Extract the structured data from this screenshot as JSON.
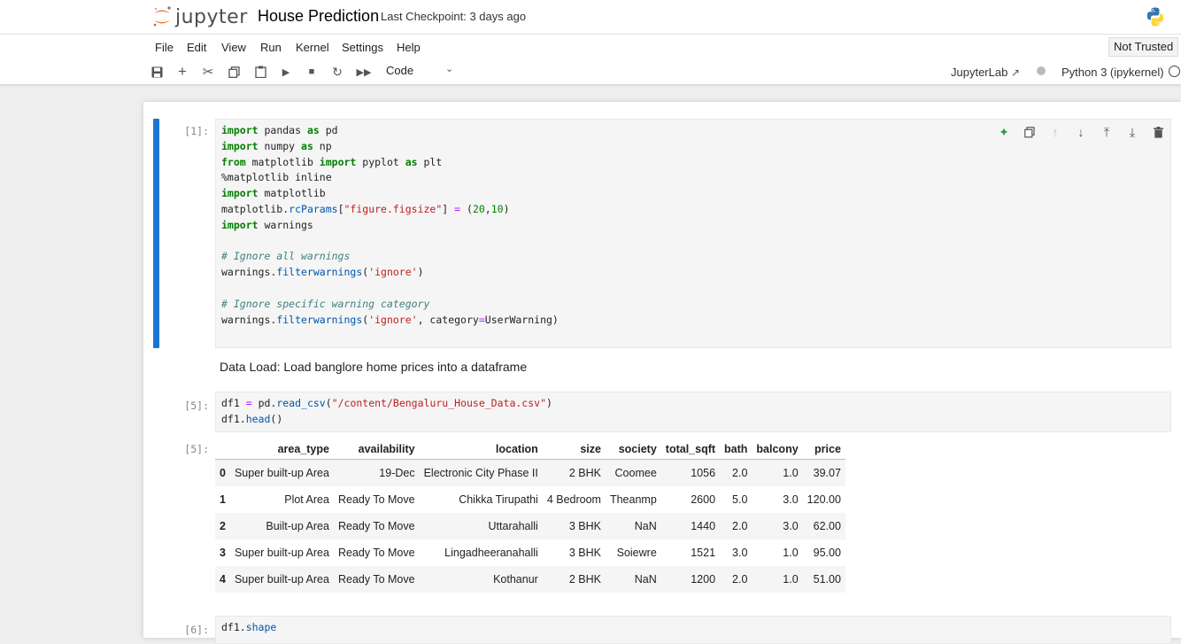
{
  "header": {
    "logo_text": "jupyter",
    "notebook_title": "House Prediction",
    "checkpoint": "Last Checkpoint: 3 days ago"
  },
  "menu": {
    "items": [
      "File",
      "Edit",
      "View",
      "Run",
      "Kernel",
      "Settings",
      "Help"
    ],
    "trust_status": "Not Trusted"
  },
  "toolbar": {
    "cell_type": "Code",
    "jupyterlab_link": "JupyterLab",
    "kernel": "Python 3 (ipykernel)"
  },
  "cells": [
    {
      "prompt": "[1]:",
      "lines": [
        "import pandas as pd",
        "import numpy as np",
        "from matplotlib import pyplot as plt",
        "%matplotlib inline",
        "import matplotlib",
        "matplotlib.rcParams[\"figure.figsize\"] = (20,10)",
        "import warnings",
        "",
        "# Ignore all warnings",
        "warnings.filterwarnings('ignore')",
        "",
        "# Ignore specific warning category",
        "warnings.filterwarnings('ignore', category=UserWarning)"
      ]
    },
    {
      "markdown": "Data Load: Load banglore home prices into a dataframe"
    },
    {
      "prompt": "[5]:",
      "lines": [
        "df1 = pd.read_csv(\"/content/Bengaluru_House_Data.csv\")",
        "df1.head()"
      ],
      "output_prompt": "[5]:",
      "table": {
        "columns": [
          "",
          "area_type",
          "availability",
          "location",
          "size",
          "society",
          "total_sqft",
          "bath",
          "balcony",
          "price"
        ],
        "rows": [
          [
            "0",
            "Super built-up Area",
            "19-Dec",
            "Electronic City Phase II",
            "2 BHK",
            "Coomee",
            "1056",
            "2.0",
            "1.0",
            "39.07"
          ],
          [
            "1",
            "Plot Area",
            "Ready To Move",
            "Chikka Tirupathi",
            "4 Bedroom",
            "Theanmp",
            "2600",
            "5.0",
            "3.0",
            "120.00"
          ],
          [
            "2",
            "Built-up Area",
            "Ready To Move",
            "Uttarahalli",
            "3 BHK",
            "NaN",
            "1440",
            "2.0",
            "3.0",
            "62.00"
          ],
          [
            "3",
            "Super built-up Area",
            "Ready To Move",
            "Lingadheeranahalli",
            "3 BHK",
            "Soiewre",
            "1521",
            "3.0",
            "1.0",
            "95.00"
          ],
          [
            "4",
            "Super built-up Area",
            "Ready To Move",
            "Kothanur",
            "2 BHK",
            "NaN",
            "1200",
            "2.0",
            "1.0",
            "51.00"
          ]
        ]
      }
    },
    {
      "prompt": "[6]:",
      "lines": [
        "df1.shape"
      ]
    }
  ]
}
